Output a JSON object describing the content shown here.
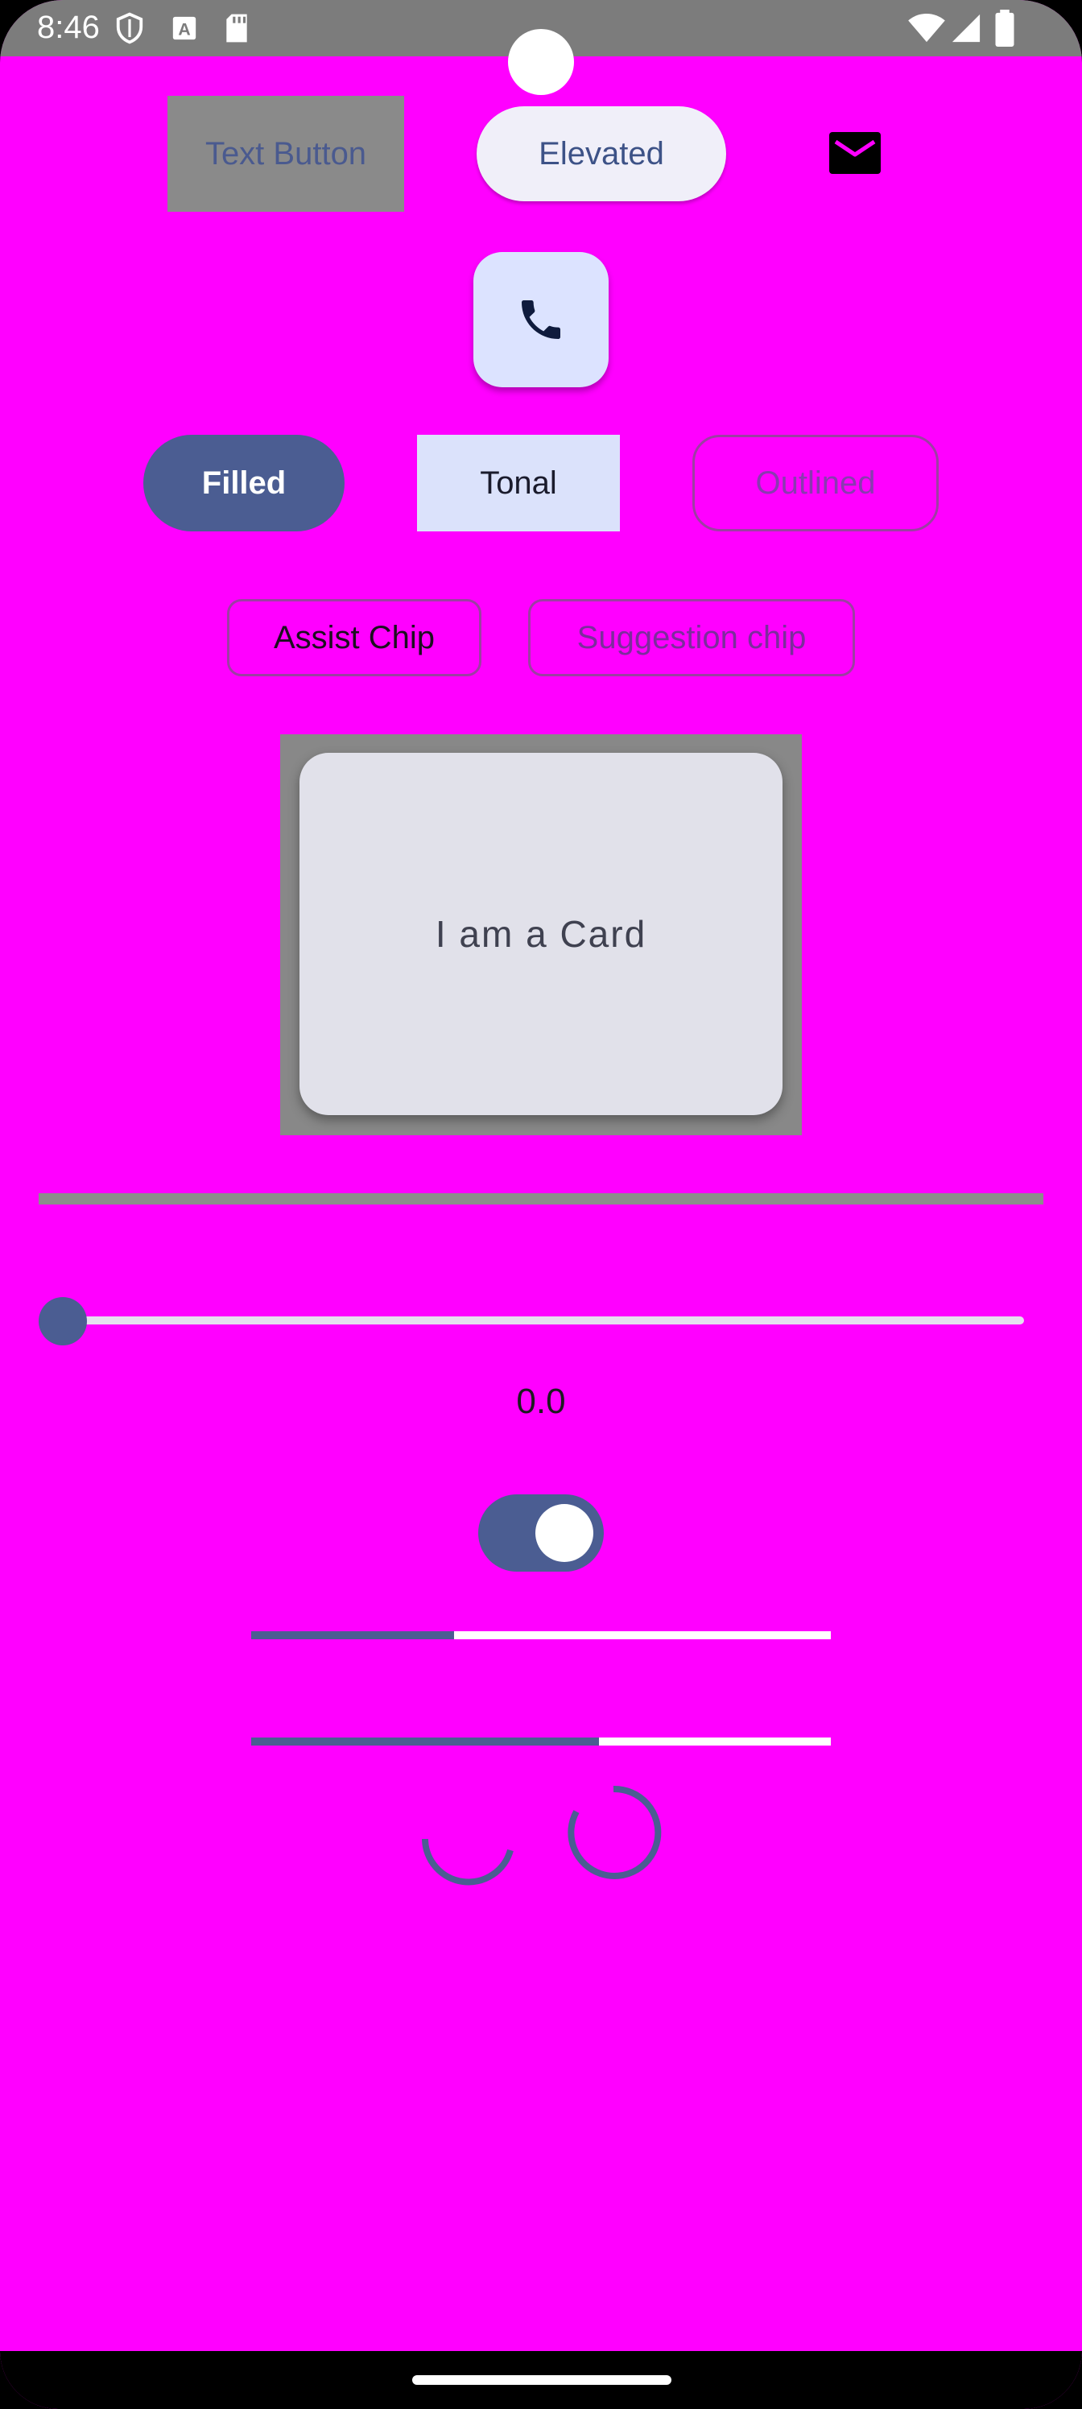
{
  "status_bar": {
    "time": "8:46",
    "icons": [
      "shield-icon",
      "keyboard-a-icon",
      "sd-card-icon",
      "wifi-icon",
      "signal-icon",
      "battery-icon"
    ]
  },
  "buttons": {
    "text_button": "Text Button",
    "elevated": "Elevated",
    "filled": "Filled",
    "tonal": "Tonal",
    "outlined": "Outlined"
  },
  "icons": {
    "icon_button": "mail-icon",
    "fab": "phone-icon"
  },
  "chips": {
    "assist": "Assist Chip",
    "suggestion": "Suggestion chip"
  },
  "card": {
    "text": "I am a Card"
  },
  "slider": {
    "value": 0.0,
    "value_label": "0.0"
  },
  "switch": {
    "checked": true
  },
  "progress": {
    "linear_1": 0.35,
    "linear_2": 0.6
  },
  "colors": {
    "background": "#ff00ff",
    "primary": "#4b5d92",
    "status_bar": "#7c7c7c"
  }
}
